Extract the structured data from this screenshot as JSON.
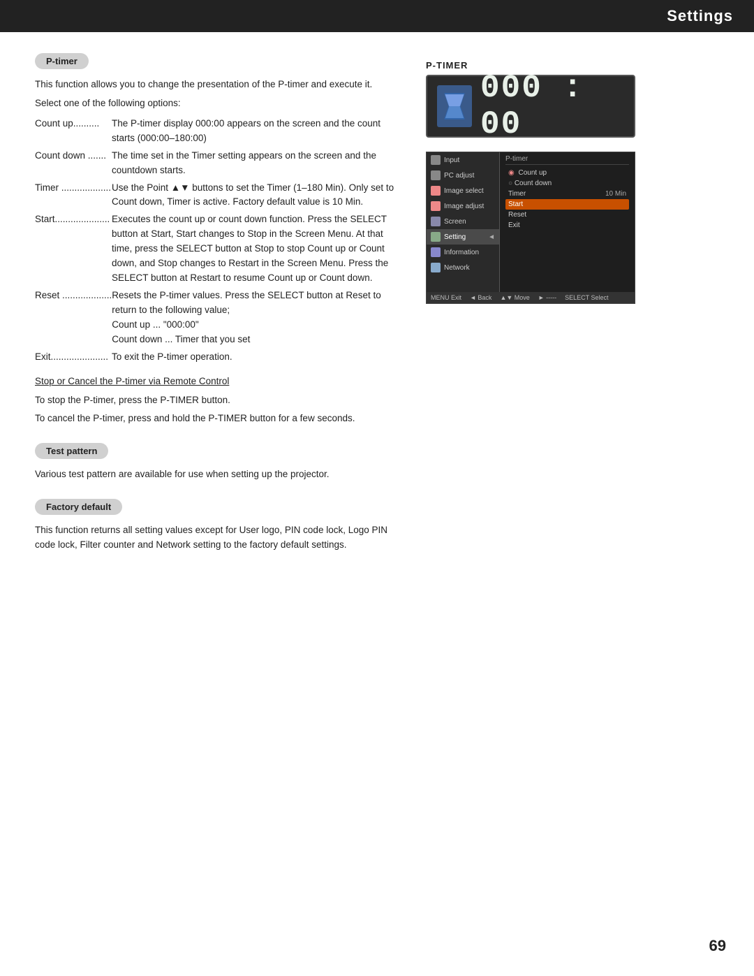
{
  "header": {
    "title": "Settings"
  },
  "page_number": "69",
  "left": {
    "ptimer_section": {
      "label": "P-timer",
      "intro": "This function allows you to change the presentation of the P-timer and execute it.",
      "select_prompt": "Select one of the following options:",
      "options": [
        {
          "name": "Count up............",
          "desc": "The P-timer display 000:00 appears on the screen and the count starts (000:00–180:00)"
        },
        {
          "name": "Count down .......",
          "desc": "The time set in the Timer setting appears on the screen and the countdown starts."
        },
        {
          "name": "Timer ...................",
          "desc": "Use the Point ▲▼ buttons to set the Timer (1–180 Min). Only set to Count down, Timer is active. Factory default value is 10 Min."
        },
        {
          "name": "Start...................",
          "desc": "Executes the count up or count down function. Press the SELECT button at Start, Start changes to Stop in the Screen Menu.  At that time, press the SELECT button at Stop to stop Count up or Count down,  and Stop changes to Restart in the Screen Menu. Press the SELECT button at Restart to resume Count up or Count down."
        },
        {
          "name": "Reset ..................",
          "desc": "Resets the P-timer values. Press the SELECT button at Reset to return to the following value;\nCount up ... \"000:00\"\nCount down ... Timer that you set"
        },
        {
          "name": "Exit......................",
          "desc": "To exit the P-timer operation."
        }
      ],
      "stop_cancel_link": "Stop or Cancel the P-timer via Remote Control",
      "stop_text": "To stop the P-timer, press the P-TIMER button.",
      "cancel_text": "To cancel the P-timer, press and hold the P-TIMER button for a few seconds."
    },
    "test_pattern_section": {
      "label": "Test pattern",
      "desc": "Various test pattern are available for use when setting up the projector."
    },
    "factory_default_section": {
      "label": "Factory default",
      "desc": "This function returns all setting values except for User logo, PIN code lock, Logo PIN code lock, Filter counter and Network setting to the factory default settings."
    }
  },
  "right": {
    "ptimer_display": {
      "label": "P-TIMER",
      "time": "000 : 00"
    },
    "menu": {
      "left_items": [
        {
          "icon": "input",
          "label": "Input"
        },
        {
          "icon": "pc",
          "label": "PC adjust"
        },
        {
          "icon": "image",
          "label": "Image select"
        },
        {
          "icon": "imageadj",
          "label": "Image adjust"
        },
        {
          "icon": "screen",
          "label": "Screen"
        },
        {
          "icon": "setting",
          "label": "Setting",
          "active": true
        },
        {
          "icon": "info",
          "label": "Information"
        },
        {
          "icon": "network",
          "label": "Network"
        }
      ],
      "right_title": "P-timer",
      "right_items": [
        {
          "label": "Count up",
          "bullet": true,
          "selected": false
        },
        {
          "label": "Count down",
          "bullet": true,
          "selected": false
        },
        {
          "label": "Timer",
          "value": "10 Min",
          "selected": false
        },
        {
          "label": "Start",
          "selected": true
        },
        {
          "label": "Reset",
          "selected": false
        },
        {
          "label": "Exit",
          "selected": false
        }
      ],
      "bottom_bar": [
        "MENU Exit",
        "◄ Back",
        "▲▼ Move",
        "► -----",
        "SELECT Select"
      ]
    }
  }
}
